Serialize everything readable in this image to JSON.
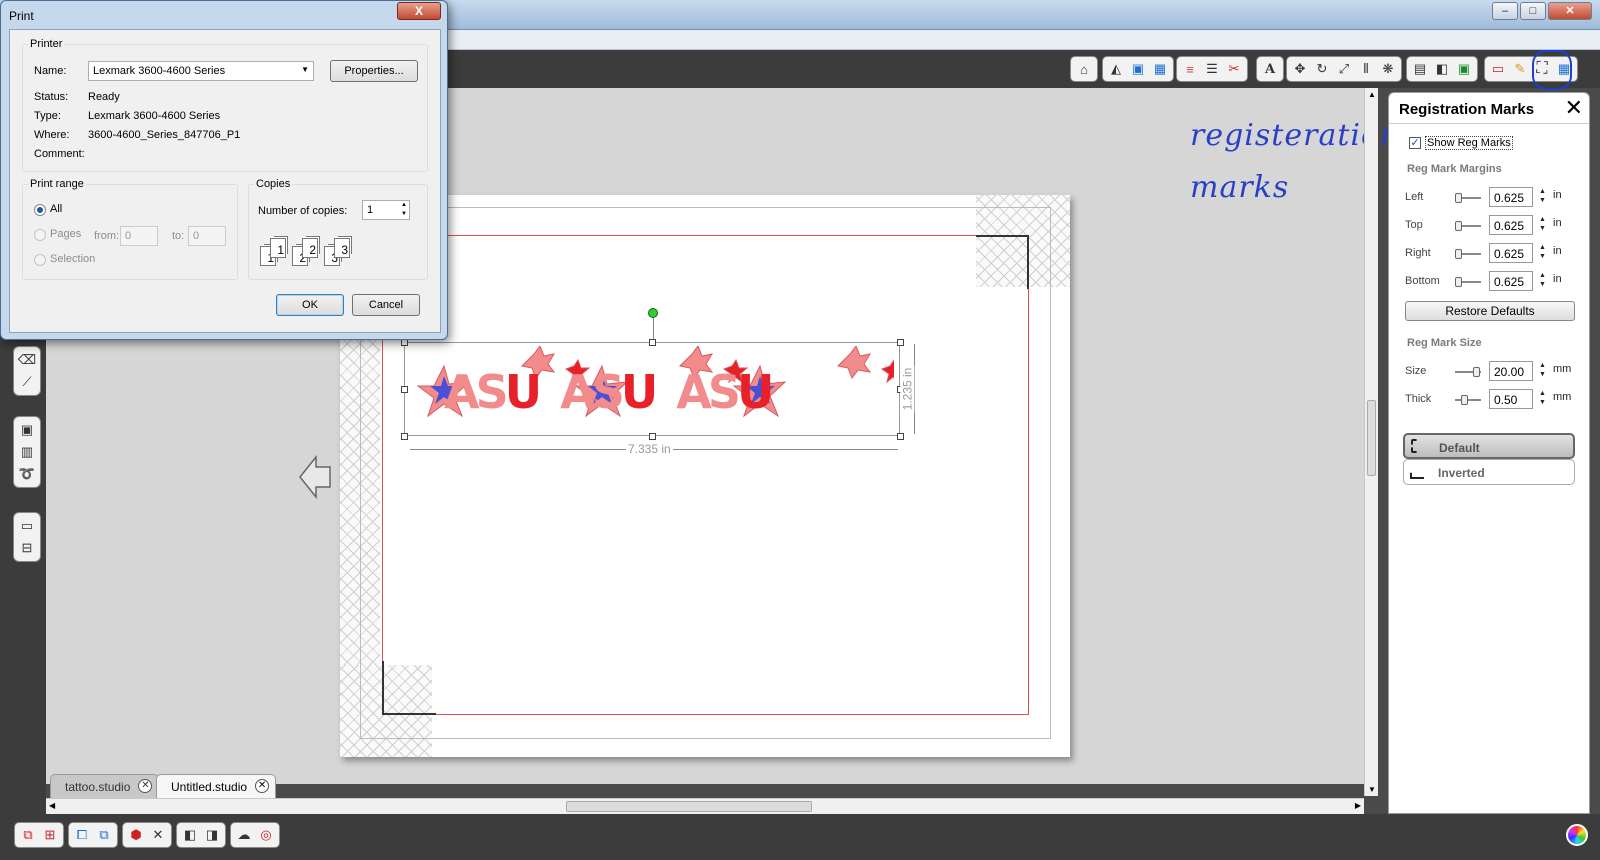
{
  "print_dialog": {
    "title": "Print",
    "close_label": "X",
    "printer_group": "Printer",
    "name_label": "Name:",
    "name_value": "Lexmark 3600-4600 Series",
    "properties_button": "Properties...",
    "status_label": "Status:",
    "status_value": "Ready",
    "type_label": "Type:",
    "type_value": "Lexmark 3600-4600 Series",
    "where_label": "Where:",
    "where_value": "3600-4600_Series_847706_P1",
    "comment_label": "Comment:",
    "comment_value": "",
    "print_range_group": "Print range",
    "range_all": "All",
    "range_pages": "Pages",
    "from_label": "from:",
    "from_value": "0",
    "to_label": "to:",
    "to_value": "0",
    "range_selection": "Selection",
    "copies_group": "Copies",
    "copies_label": "Number of copies:",
    "copies_value": "1",
    "collate_pages": [
      "1",
      "1",
      "2",
      "2",
      "3",
      "3"
    ],
    "ok_button": "OK",
    "cancel_button": "Cancel"
  },
  "canvas": {
    "selection_width": "7.335 in",
    "selection_height": "1.235 in",
    "design_text": [
      "A",
      "S",
      "U",
      "A",
      "S",
      "U",
      "A",
      "S",
      "U"
    ]
  },
  "tabs": [
    {
      "label": "tattoo.studio",
      "close": "✕"
    },
    {
      "label": "Untitled.studio",
      "close": "✕"
    }
  ],
  "annotation": {
    "line1": "registeration",
    "line2": "marks"
  },
  "panel": {
    "title": "Registration Marks",
    "close": "✕",
    "show_reg_marks": "Show Reg Marks",
    "margins_title": "Reg Mark Margins",
    "margins": [
      {
        "label": "Left",
        "value": "0.625",
        "unit": "in"
      },
      {
        "label": "Top",
        "value": "0.625",
        "unit": "in"
      },
      {
        "label": "Right",
        "value": "0.625",
        "unit": "in"
      },
      {
        "label": "Bottom",
        "value": "0.625",
        "unit": "in"
      }
    ],
    "restore_defaults": "Restore Defaults",
    "size_title": "Reg Mark Size",
    "size_label": "Size",
    "size_value": "20.00",
    "size_unit": "mm",
    "thick_label": "Thick",
    "thick_value": "0.50",
    "thick_unit": "mm",
    "style_default": "Default",
    "style_inverted": "Inverted"
  },
  "colors": {
    "accent_circle": "#1c3fd6",
    "reg_line": "#e05050",
    "design_red": "#e8202a",
    "design_pink": "#f28c8c",
    "design_star_blue": "#4b4fd6"
  },
  "icons": [
    "home-icon",
    "eraser-icon",
    "fill-icon",
    "grid-icon",
    "lines-icon",
    "knife-icon",
    "text-icon",
    "move-icon",
    "rotate-icon",
    "scale-icon",
    "align-icon",
    "replicate-icon",
    "library-icon",
    "store-icon",
    "register-icon",
    "page-icon",
    "pen-icon",
    "regmark-icon",
    "cutsettings-icon"
  ]
}
